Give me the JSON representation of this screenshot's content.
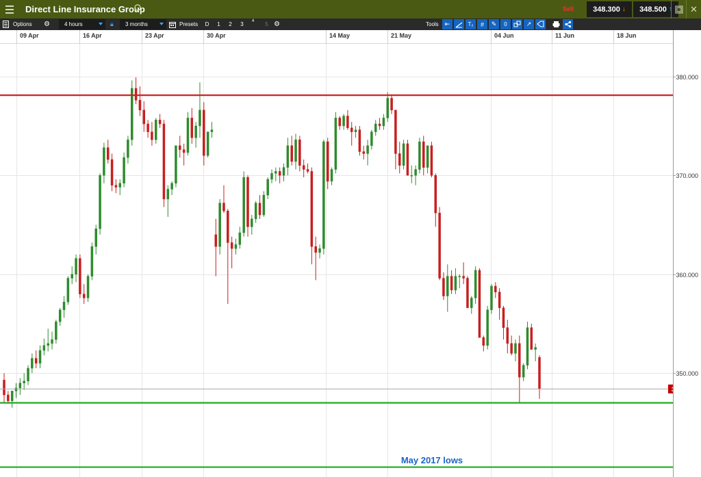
{
  "titlebar": {
    "title": "Direct Line Insurance Group",
    "sell_label": "Sell",
    "sell_price": "348.300",
    "buy_price": "348.500"
  },
  "toolbar": {
    "options_label": "Options",
    "interval_value": "4 hours",
    "range_value": "3 months",
    "presets_label": "Presets",
    "presets": [
      "D",
      "1",
      "2",
      "3",
      "4",
      "5"
    ],
    "tools_label": "Tools"
  },
  "icons": [
    "menu-icon",
    "search-icon",
    "settings-icon",
    "lock-icon",
    "calendar-icon",
    "arrow-left-icon",
    "line-icon",
    "text-icon",
    "grid-icon",
    "pen-icon",
    "circle-icon",
    "shapes-icon",
    "fib-icon",
    "channel-icon",
    "cursor-icon",
    "print-icon",
    "share-icon",
    "restore-icon",
    "close-icon"
  ],
  "colors": {
    "up": "#2e8b2e",
    "down": "#c81e1e",
    "resistance": "#cc2222",
    "support": "#1faa1f",
    "price_tag": "#c00000",
    "annotation": "#1a64c8"
  },
  "chart_data": {
    "type": "candlestick",
    "title": "Direct Line Insurance Group",
    "timeframe": "4 hours",
    "x_ticks": [
      "09 Apr",
      "16 Apr",
      "23 Apr",
      "30 Apr",
      "14 May",
      "21 May",
      "04 Jun",
      "11 Jun",
      "18 Jun"
    ],
    "y_ticks": [
      "380.000",
      "370.000",
      "360.000",
      "350.000"
    ],
    "y_tick_values": [
      380,
      370,
      360,
      350
    ],
    "ylim": [
      339.5,
      383.3
    ],
    "grid": true,
    "levels": [
      {
        "label": "378.100",
        "value": 378.1,
        "style": "resistance"
      },
      {
        "label": "347.000",
        "value": 347.0,
        "style": "support"
      },
      {
        "label": "340.500",
        "value": 340.5,
        "style": "support"
      }
    ],
    "current_price": {
      "label": "348.4000",
      "value": 348.4
    },
    "annotation": "May 2017 lows",
    "candles": [
      [
        349.3,
        350.0,
        347.0,
        347.8
      ],
      [
        347.8,
        348.2,
        346.9,
        347.2
      ],
      [
        347.2,
        348.0,
        346.5,
        348.2
      ],
      [
        348.2,
        349.0,
        347.5,
        348.5
      ],
      [
        348.5,
        349.5,
        347.8,
        349.0
      ],
      [
        349.0,
        350.0,
        348.3,
        349.2
      ],
      [
        349.2,
        350.8,
        348.8,
        350.5
      ],
      [
        350.5,
        352.0,
        350.0,
        351.5
      ],
      [
        351.5,
        352.3,
        350.5,
        351.0
      ],
      [
        351.0,
        352.8,
        350.5,
        352.3
      ],
      [
        352.3,
        353.5,
        351.8,
        352.8
      ],
      [
        352.8,
        354.5,
        352.2,
        353.0
      ],
      [
        353.0,
        354.2,
        352.4,
        353.4
      ],
      [
        353.4,
        355.4,
        353.0,
        355.2
      ],
      [
        355.2,
        356.6,
        354.8,
        356.4
      ],
      [
        356.4,
        357.8,
        355.6,
        357.2
      ],
      [
        357.2,
        359.8,
        356.9,
        359.6
      ],
      [
        359.6,
        360.8,
        359.0,
        360.0
      ],
      [
        360.0,
        362.0,
        359.2,
        361.6
      ],
      [
        361.6,
        362.0,
        357.6,
        358.0
      ],
      [
        358.0,
        359.0,
        357.0,
        357.6
      ],
      [
        357.6,
        360.0,
        357.2,
        359.8
      ],
      [
        359.8,
        363.2,
        359.4,
        362.8
      ],
      [
        362.8,
        365.0,
        362.0,
        364.6
      ],
      [
        364.6,
        370.2,
        364.0,
        370.0
      ],
      [
        370.0,
        373.3,
        369.2,
        372.8
      ],
      [
        372.8,
        373.6,
        371.2,
        371.6
      ],
      [
        371.6,
        372.2,
        368.4,
        369.0
      ],
      [
        369.0,
        369.6,
        368.2,
        368.8
      ],
      [
        368.8,
        369.6,
        368.0,
        369.2
      ],
      [
        369.2,
        372.3,
        368.8,
        371.8
      ],
      [
        371.8,
        374.0,
        371.2,
        373.6
      ],
      [
        373.6,
        379.6,
        373.0,
        378.8
      ],
      [
        378.8,
        379.9,
        377.2,
        377.6
      ],
      [
        377.6,
        379.0,
        376.0,
        376.6
      ],
      [
        376.6,
        377.5,
        374.4,
        375.2
      ],
      [
        375.2,
        375.6,
        373.8,
        374.4
      ],
      [
        374.4,
        375.4,
        373.0,
        373.6
      ],
      [
        373.6,
        375.8,
        373.2,
        375.6
      ],
      [
        375.6,
        376.2,
        374.8,
        375.2
      ],
      [
        375.2,
        375.6,
        366.8,
        367.6
      ],
      [
        367.6,
        369.0,
        365.8,
        368.6
      ],
      [
        368.6,
        369.4,
        368.0,
        369.2
      ],
      [
        369.2,
        372.4,
        368.8,
        373.0
      ],
      [
        373.0,
        374.0,
        371.8,
        372.6
      ],
      [
        372.6,
        373.2,
        371.0,
        372.3
      ],
      [
        372.3,
        376.4,
        372.0,
        375.8
      ],
      [
        375.8,
        376.8,
        373.2,
        373.8
      ],
      [
        373.8,
        375.4,
        372.8,
        375.0
      ],
      [
        375.0,
        379.4,
        373.8,
        376.6
      ],
      [
        376.6,
        377.4,
        371.0,
        372.0
      ],
      [
        372.0,
        373.0,
        371.8,
        374.4
      ],
      [
        374.4,
        375.4,
        373.8,
        374.6
      ],
      [
        364.0,
        365.6,
        359.8,
        362.8
      ],
      [
        362.8,
        367.6,
        362.0,
        367.2
      ],
      [
        367.2,
        369.0,
        366.2,
        366.4
      ],
      [
        366.4,
        366.6,
        357.0,
        363.2
      ],
      [
        363.2,
        363.8,
        360.6,
        362.6
      ],
      [
        362.6,
        363.6,
        362.0,
        363.0
      ],
      [
        363.0,
        364.8,
        362.6,
        364.2
      ],
      [
        364.2,
        370.4,
        363.8,
        369.8
      ],
      [
        369.8,
        370.0,
        363.8,
        364.8
      ],
      [
        364.8,
        366.0,
        364.0,
        365.6
      ],
      [
        365.6,
        367.4,
        365.2,
        367.2
      ],
      [
        367.2,
        368.0,
        365.6,
        366.0
      ],
      [
        366.0,
        368.4,
        365.8,
        368.0
      ],
      [
        368.0,
        369.8,
        367.6,
        369.6
      ],
      [
        369.6,
        370.6,
        369.2,
        370.2
      ],
      [
        370.2,
        370.8,
        369.4,
        370.4
      ],
      [
        370.4,
        370.8,
        369.2,
        370.0
      ],
      [
        370.0,
        371.2,
        369.4,
        370.8
      ],
      [
        370.8,
        373.8,
        370.0,
        373.0
      ],
      [
        373.0,
        374.0,
        371.0,
        371.4
      ],
      [
        371.4,
        374.2,
        370.6,
        373.6
      ],
      [
        373.6,
        374.0,
        370.4,
        371.0
      ],
      [
        371.0,
        371.6,
        369.8,
        370.6
      ],
      [
        370.6,
        371.2,
        370.2,
        370.4
      ],
      [
        370.4,
        370.8,
        361.0,
        362.8
      ],
      [
        362.8,
        363.8,
        359.4,
        362.2
      ],
      [
        362.2,
        363.0,
        361.6,
        362.6
      ],
      [
        362.6,
        373.6,
        362.0,
        373.4
      ],
      [
        373.4,
        373.8,
        368.6,
        369.4
      ],
      [
        369.4,
        370.8,
        369.0,
        370.6
      ],
      [
        370.6,
        376.4,
        370.2,
        375.8
      ],
      [
        375.8,
        376.0,
        374.6,
        375.0
      ],
      [
        375.0,
        376.2,
        374.6,
        376.0
      ],
      [
        376.0,
        376.6,
        374.6,
        374.8
      ],
      [
        374.8,
        375.4,
        373.0,
        374.4
      ],
      [
        374.4,
        375.0,
        373.8,
        374.6
      ],
      [
        374.6,
        375.0,
        372.0,
        372.4
      ],
      [
        372.4,
        373.0,
        371.6,
        372.2
      ],
      [
        372.2,
        373.6,
        371.0,
        373.0
      ],
      [
        373.0,
        374.6,
        372.6,
        374.4
      ],
      [
        374.4,
        375.6,
        374.0,
        375.2
      ],
      [
        375.2,
        375.8,
        374.6,
        375.0
      ],
      [
        375.0,
        376.2,
        374.6,
        375.8
      ],
      [
        375.8,
        378.4,
        375.4,
        377.8
      ],
      [
        377.8,
        378.2,
        376.2,
        376.6
      ],
      [
        376.6,
        376.6,
        370.6,
        372.2
      ],
      [
        372.2,
        373.4,
        370.2,
        371.0
      ],
      [
        371.0,
        373.6,
        370.6,
        373.2
      ],
      [
        373.2,
        373.6,
        370.8,
        370.0
      ],
      [
        370.0,
        371.0,
        369.2,
        370.0
      ],
      [
        370.0,
        371.0,
        369.0,
        370.6
      ],
      [
        370.6,
        373.8,
        370.2,
        373.4
      ],
      [
        373.4,
        374.0,
        370.0,
        370.8
      ],
      [
        370.8,
        371.8,
        370.2,
        373.0
      ],
      [
        373.0,
        373.4,
        369.8,
        370.0
      ],
      [
        370.0,
        370.2,
        364.8,
        366.2
      ],
      [
        366.2,
        366.8,
        359.4,
        359.6
      ],
      [
        359.6,
        360.2,
        357.4,
        357.8
      ],
      [
        357.8,
        361.0,
        356.2,
        359.8
      ],
      [
        359.8,
        360.4,
        358.0,
        358.4
      ],
      [
        358.4,
        360.6,
        358.0,
        359.8
      ],
      [
        359.8,
        360.0,
        358.6,
        359.8
      ],
      [
        359.8,
        361.2,
        359.0,
        359.6
      ],
      [
        359.6,
        359.8,
        358.0,
        356.6
      ],
      [
        356.6,
        357.8,
        356.0,
        357.6
      ],
      [
        357.6,
        360.8,
        357.0,
        360.4
      ],
      [
        360.4,
        360.6,
        356.4,
        353.6
      ],
      [
        353.6,
        353.8,
        352.2,
        352.8
      ],
      [
        352.8,
        356.8,
        352.4,
        356.4
      ],
      [
        356.4,
        359.0,
        356.0,
        358.8
      ],
      [
        358.8,
        359.2,
        357.6,
        358.2
      ],
      [
        358.2,
        358.6,
        355.4,
        356.6
      ],
      [
        356.6,
        356.8,
        353.4,
        354.6
      ],
      [
        354.6,
        355.4,
        352.0,
        353.0
      ],
      [
        353.0,
        353.8,
        351.8,
        352.0
      ],
      [
        352.0,
        353.4,
        351.2,
        353.0
      ],
      [
        353.0,
        353.8,
        347.0,
        349.6
      ],
      [
        349.6,
        351.0,
        349.2,
        350.8
      ],
      [
        350.8,
        355.2,
        350.4,
        354.6
      ],
      [
        354.6,
        355.0,
        352.6,
        352.4
      ],
      [
        352.4,
        353.0,
        351.2,
        352.6
      ],
      [
        351.6,
        351.8,
        347.4,
        348.4
      ]
    ]
  }
}
